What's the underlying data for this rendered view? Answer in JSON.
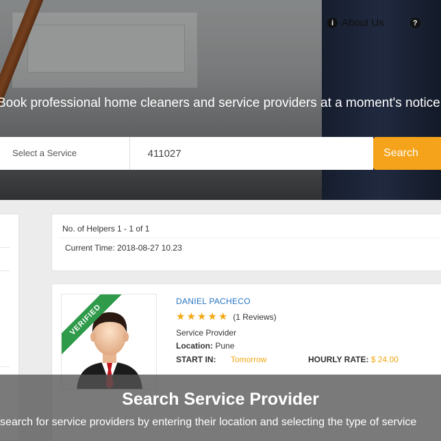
{
  "nav": {
    "about_label": "About Us",
    "about_icon": "info-icon",
    "help_icon": "help-icon"
  },
  "hero": {
    "title": "Book professional home cleaners and service providers at a moment's notice."
  },
  "search": {
    "service_placeholder": "Select a Service",
    "location_value": "411027",
    "button_label": "Search"
  },
  "results": {
    "count_text": "No. of Helpers 1 - 1 of 1",
    "current_time": "Current Time: 2018-08-27 10.23"
  },
  "provider": {
    "badge": "VERIFIED",
    "name": "DANIEL PACHECO",
    "rating": 5,
    "reviews": "(1 Reviews)",
    "type": "Service Provider",
    "location_label": "Location:",
    "location_value": "Pune",
    "start_label": "START IN:",
    "start_value": "Tomorrow",
    "rate_label": "HOURLY RATE:",
    "rate_value": "$ 24.00"
  },
  "caption": {
    "title": "Search Service Provider",
    "text": "search for service providers by entering their location and selecting the type of service"
  },
  "colors": {
    "accent": "#f5a31a",
    "link": "#2673c4",
    "verified": "#2e9a4a"
  }
}
